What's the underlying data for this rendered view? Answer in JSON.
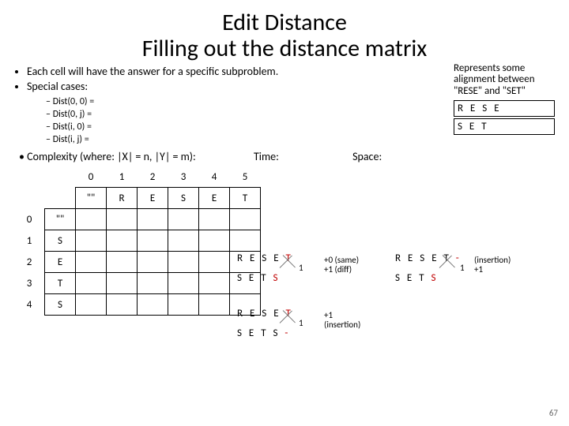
{
  "title1": "Edit Distance",
  "title2": "Filling out the distance matrix",
  "bullets1": [
    "Each cell will have the answer for a specific subproblem.",
    "Special cases:"
  ],
  "bullets2": [
    "Dist(0, 0)  =",
    "Dist(0, j)  =",
    "Dist(i, 0)  =",
    "Dist(i, j)  ="
  ],
  "complexity": "Complexity (where: |X| = n, |Y| = m):",
  "time_label": "Time:",
  "space_label": "Space:",
  "table": {
    "cols": [
      "0",
      "1",
      "2",
      "3",
      "4",
      "5"
    ],
    "cols2": [
      "\"\"",
      "R",
      "E",
      "S",
      "E",
      "T"
    ],
    "rows": [
      "0",
      "1",
      "2",
      "3",
      "4"
    ],
    "rows2": [
      "\"\"",
      "S",
      "E",
      "T",
      "S"
    ]
  },
  "side": {
    "note": "Represents some alignment between \"RESE\" and \"SET\"",
    "a": "R E S E",
    "b": "S E T"
  },
  "pairs": {
    "tl": {
      "a_pre": "R E S E ",
      "a_hl": "T",
      "b_pre": "S E T ",
      "b_hl": "S",
      "one": "1",
      "ann": "+0 (same)\n+1 (diff)"
    },
    "tr": {
      "a_pre": "R E S E T ",
      "a_hl": "-",
      "b_pre": "S E T ",
      "b_hl": "S",
      "one": "1",
      "ann": "(insertion)\n+1"
    },
    "bl": {
      "a_pre": "R E S E ",
      "a_hl": "T",
      "b_pre": "S E T S ",
      "b_hl": "-",
      "one": "1",
      "ann": "+1\n(insertion)"
    }
  },
  "page": "67"
}
